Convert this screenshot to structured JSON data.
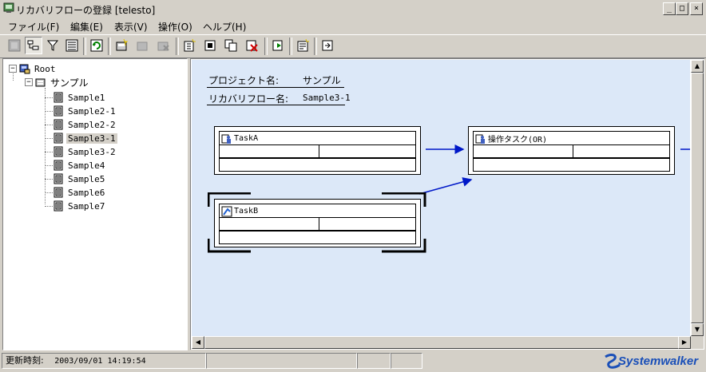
{
  "window": {
    "title": "リカバリフローの登録 [telesto]",
    "controls": {
      "minimize": "_",
      "maximize": "□",
      "close": "×"
    }
  },
  "menu": {
    "items": [
      "ファイル(F)",
      "編集(E)",
      "表示(V)",
      "操作(O)",
      "ヘルプ(H)"
    ]
  },
  "toolbar": {
    "buttons": [
      {
        "icon": "properties-icon",
        "state": "disabled"
      },
      {
        "icon": "tree-view-icon",
        "state": "pressed"
      },
      {
        "icon": "filter-icon",
        "state": "normal"
      },
      {
        "icon": "list-view-icon",
        "state": "normal"
      },
      {
        "icon": "refresh-icon",
        "state": "normal"
      },
      {
        "icon": "new-project-icon",
        "state": "normal"
      },
      {
        "icon": "edit-project-icon",
        "state": "disabled"
      },
      {
        "icon": "delete-project-icon",
        "state": "disabled"
      },
      {
        "icon": "new-flow-icon",
        "state": "normal"
      },
      {
        "icon": "open-flow-icon",
        "state": "normal"
      },
      {
        "icon": "copy-flow-icon",
        "state": "normal"
      },
      {
        "icon": "delete-flow-icon",
        "state": "normal"
      },
      {
        "icon": "run-flow-icon",
        "state": "normal"
      },
      {
        "icon": "flow-properties-icon",
        "state": "normal"
      },
      {
        "icon": "export-icon",
        "state": "normal"
      }
    ]
  },
  "tree": {
    "root": {
      "label": "Root",
      "icon": "root-server-icon",
      "expanded": true
    },
    "project": {
      "label": "サンプル",
      "icon": "project-icon",
      "expanded": true
    },
    "flows": [
      "Sample1",
      "Sample2-1",
      "Sample2-2",
      "Sample3-1",
      "Sample3-2",
      "Sample4",
      "Sample5",
      "Sample6",
      "Sample7"
    ],
    "selected": "Sample3-1"
  },
  "canvas": {
    "project_label": "プロジェクト名:",
    "project_value": "サンプル",
    "flow_label": "リカバリフロー名:",
    "flow_value": "Sample3-1",
    "tasks": [
      {
        "name": "TaskA",
        "icon": "task-person-icon",
        "selected": false
      },
      {
        "name": "操作タスク(OR)",
        "icon": "task-person-icon",
        "selected": false
      },
      {
        "name": "TaskB",
        "icon": "task-auto-icon",
        "selected": true
      }
    ]
  },
  "status": {
    "label": "更新時刻:",
    "time": "2003/09/01 14:19:54"
  },
  "logo": {
    "text": "Systemwalker"
  },
  "colors": {
    "canvas_bg": "#dce8f8",
    "arrow": "#0018c8",
    "chrome": "#d4d0c8"
  }
}
